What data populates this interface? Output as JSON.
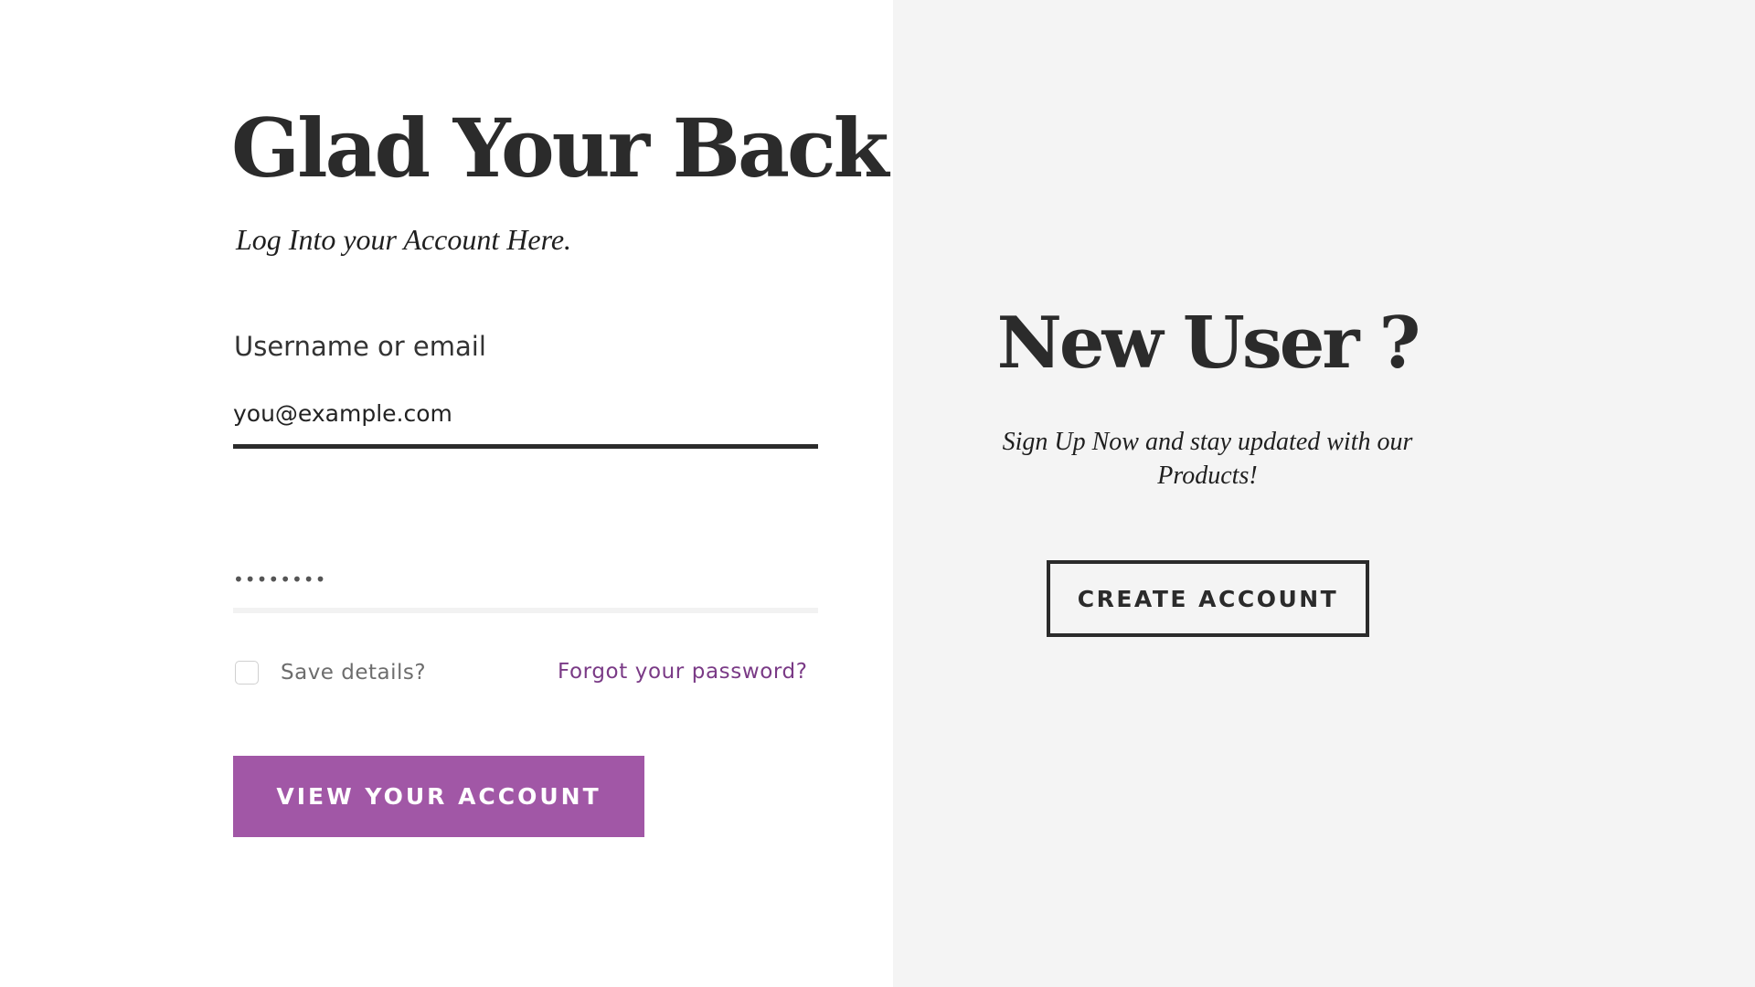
{
  "login": {
    "title": "Glad Your Back!",
    "subtitle": "Log Into your Account Here.",
    "username_label": "Username or email",
    "username_value": "you@example.com",
    "password_value": "••••••••",
    "save_details_label": "Save details?",
    "save_details_checked": false,
    "forgot_password_link": "Forgot your password?",
    "submit_button": "VIEW YOUR ACCOUNT"
  },
  "signup": {
    "title": "New User ?",
    "text": "Sign Up Now  and stay updated with our Products!",
    "button": "CREATE ACCOUNT"
  },
  "colors": {
    "accent": "#a157a6",
    "link": "#7a3a86",
    "dark": "#2b2b2b",
    "panel_background": "#f4f4f4"
  }
}
